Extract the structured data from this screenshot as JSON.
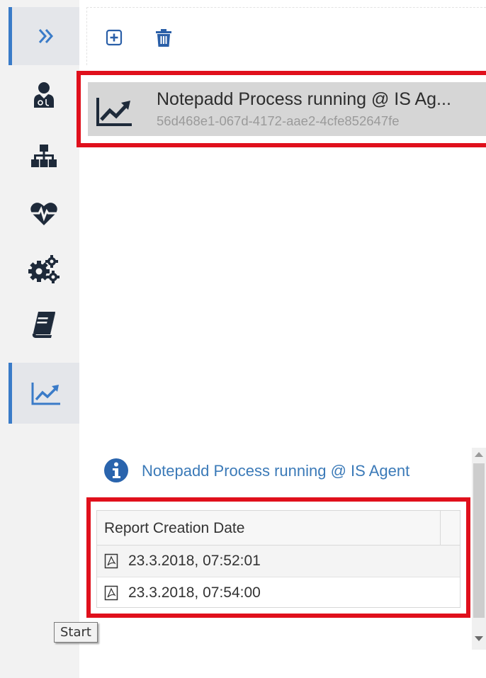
{
  "sidebar": {
    "items": [
      {
        "icon": "double-chevron-right-icon"
      },
      {
        "icon": "user-doctor-icon"
      },
      {
        "icon": "hierarchy-icon"
      },
      {
        "icon": "heartbeat-icon"
      },
      {
        "icon": "cogs-icon"
      },
      {
        "icon": "book-icon"
      },
      {
        "icon": "trend-chart-icon",
        "selected": true
      }
    ]
  },
  "toolbar": {
    "add_icon": "plus-square-icon",
    "delete_icon": "trash-icon"
  },
  "process": {
    "title": "Notepadd Process running @ IS Ag...",
    "id": "56d468e1-067d-4172-aae2-4cfe852647fe"
  },
  "info": {
    "text": "Notepadd Process running @ IS Agent"
  },
  "report": {
    "header": "Report Creation Date",
    "rows": [
      {
        "date": "23.3.2018, 07:52:01"
      },
      {
        "date": "23.3.2018, 07:54:00"
      }
    ]
  },
  "tooltip": {
    "text": "Start"
  },
  "colors": {
    "accent": "#3a7bc8",
    "icon_dark": "#1e2a3a",
    "highlight": "#e0101c",
    "link": "#3b7ab8"
  }
}
